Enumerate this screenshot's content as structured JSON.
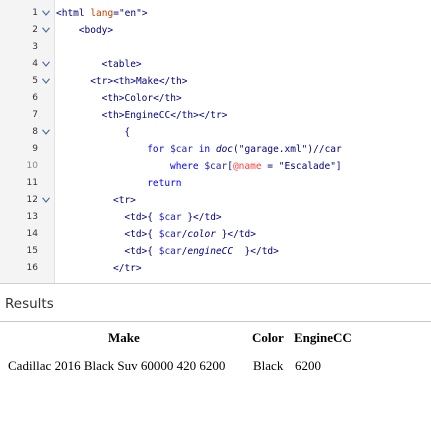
{
  "editor": {
    "lines": [
      {
        "num": "1",
        "fold": true,
        "dim": false,
        "indent": 0,
        "tokens": [
          {
            "t": "<html ",
            "c": "t-tag"
          },
          {
            "t": "lang",
            "c": "t-attr"
          },
          {
            "t": "=\"en\">",
            "c": "t-str"
          }
        ]
      },
      {
        "num": "2",
        "fold": true,
        "dim": false,
        "indent": 4,
        "tokens": [
          {
            "t": "<body>",
            "c": "t-tag"
          }
        ]
      },
      {
        "num": "3",
        "fold": false,
        "dim": false,
        "indent": 0,
        "tokens": []
      },
      {
        "num": "4",
        "fold": true,
        "dim": false,
        "indent": 8,
        "tokens": [
          {
            "t": "<table>",
            "c": "t-tag"
          }
        ]
      },
      {
        "num": "5",
        "fold": true,
        "dim": false,
        "indent": 6,
        "tokens": [
          {
            "t": "<tr><th>Make</th>",
            "c": "t-tag"
          }
        ]
      },
      {
        "num": "6",
        "fold": false,
        "dim": false,
        "indent": 8,
        "tokens": [
          {
            "t": "<th>Color</th>",
            "c": "t-tag"
          }
        ]
      },
      {
        "num": "7",
        "fold": false,
        "dim": false,
        "indent": 8,
        "tokens": [
          {
            "t": "<th>EngineCC</th></tr>",
            "c": "t-tag"
          }
        ]
      },
      {
        "num": "8",
        "fold": true,
        "dim": false,
        "indent": 12,
        "tokens": [
          {
            "t": "{",
            "c": "t-plain"
          }
        ]
      },
      {
        "num": "9",
        "fold": false,
        "dim": false,
        "indent": 16,
        "tokens": [
          {
            "t": "for ",
            "c": "t-kw"
          },
          {
            "t": "$car ",
            "c": "t-var"
          },
          {
            "t": "in ",
            "c": "t-kw"
          },
          {
            "t": "doc",
            "c": "t-fn"
          },
          {
            "t": "(\"garage.xml\")",
            "c": "t-plain"
          },
          {
            "t": "//",
            "c": "t-plain"
          },
          {
            "t": "car",
            "c": "t-plain"
          }
        ]
      },
      {
        "num": "10",
        "fold": false,
        "dim": true,
        "indent": 20,
        "tokens": [
          {
            "t": "where ",
            "c": "t-kw"
          },
          {
            "t": "$car",
            "c": "t-var"
          },
          {
            "t": "[",
            "c": "t-plain"
          },
          {
            "t": "@name",
            "c": "t-at"
          },
          {
            "t": " = ",
            "c": "t-plain"
          },
          {
            "t": "\"Escalade\"]",
            "c": "t-plain"
          }
        ]
      },
      {
        "num": "11",
        "fold": false,
        "dim": false,
        "indent": 16,
        "tokens": [
          {
            "t": "return",
            "c": "t-kw"
          }
        ]
      },
      {
        "num": "12",
        "fold": true,
        "dim": false,
        "indent": 10,
        "tokens": [
          {
            "t": "<tr>",
            "c": "t-tag"
          }
        ]
      },
      {
        "num": "13",
        "fold": false,
        "dim": false,
        "indent": 12,
        "tokens": [
          {
            "t": "<td>{ ",
            "c": "t-tag"
          },
          {
            "t": "$car",
            "c": "t-var"
          },
          {
            "t": " }</td>",
            "c": "t-tag"
          }
        ]
      },
      {
        "num": "14",
        "fold": false,
        "dim": false,
        "indent": 12,
        "tokens": [
          {
            "t": "<td>{ ",
            "c": "t-tag"
          },
          {
            "t": "$car",
            "c": "t-var"
          },
          {
            "t": "/",
            "c": "t-plain"
          },
          {
            "t": "color",
            "c": "t-fn"
          },
          {
            "t": " }</td>",
            "c": "t-tag"
          }
        ]
      },
      {
        "num": "15",
        "fold": false,
        "dim": false,
        "indent": 12,
        "tokens": [
          {
            "t": "<td>{ ",
            "c": "t-tag"
          },
          {
            "t": "$car",
            "c": "t-var"
          },
          {
            "t": "/",
            "c": "t-plain"
          },
          {
            "t": "engineCC",
            "c": "t-fn"
          },
          {
            "t": "  }</td>",
            "c": "t-tag"
          }
        ]
      },
      {
        "num": "16",
        "fold": false,
        "dim": false,
        "indent": 10,
        "tokens": [
          {
            "t": "</tr>",
            "c": "t-tag"
          }
        ]
      }
    ]
  },
  "results": {
    "title": "Results",
    "headers": [
      "Make",
      "Color",
      "EngineCC"
    ],
    "row": [
      "Cadillac 2016 Black Suv 60000 420 6200",
      "Black",
      "6200"
    ]
  }
}
